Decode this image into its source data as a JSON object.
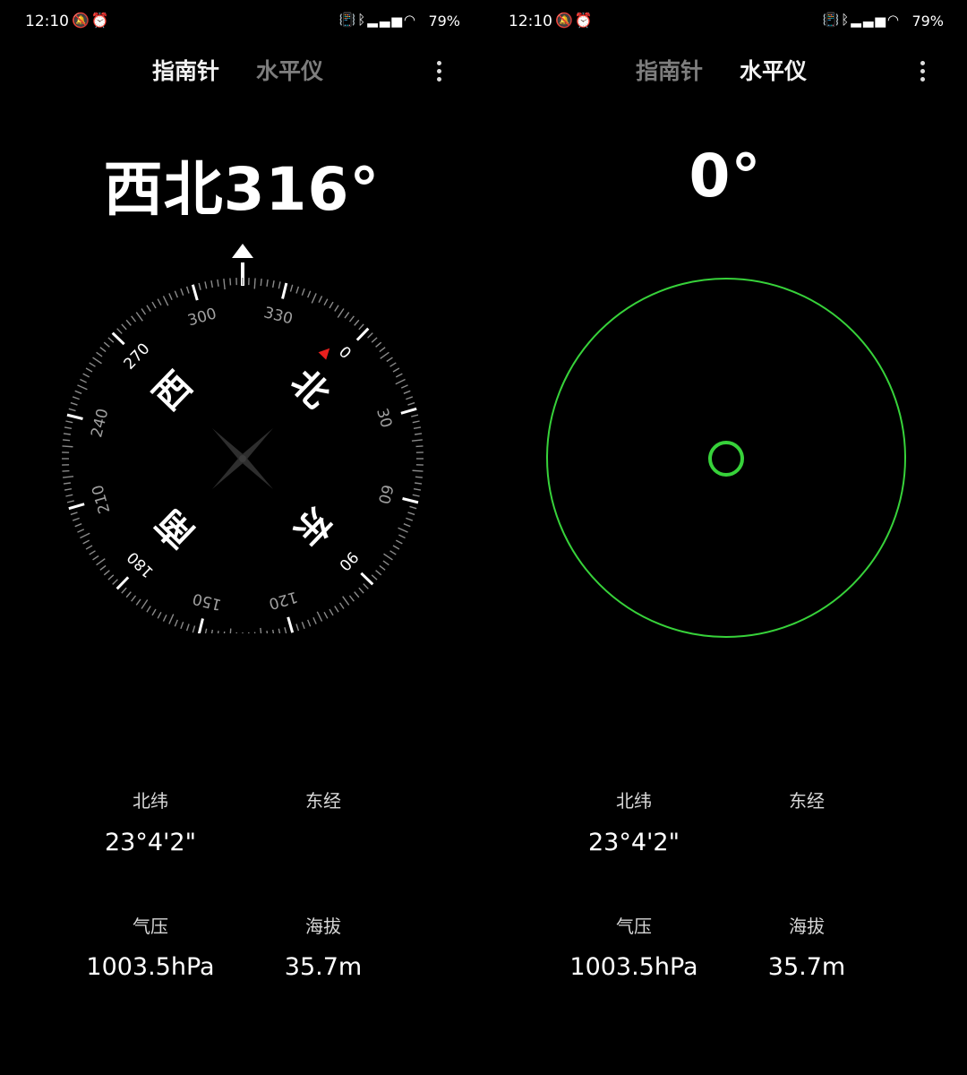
{
  "status_bar": {
    "time": "12:10",
    "battery": "79%",
    "icons": [
      "mute-icon",
      "alarm-icon",
      "vibrate-icon",
      "bluetooth-icon",
      "hd-signal-icon",
      "wifi-icon"
    ]
  },
  "tabs": [
    "指南针",
    "水平仪"
  ],
  "compass": {
    "direction": "西北",
    "degrees": "316°",
    "cardinals": {
      "north": "北",
      "east": "东",
      "south": "南",
      "west": "西"
    },
    "ring_labels": [
      "0",
      "30",
      "60",
      "90",
      "120",
      "150",
      "180",
      "210",
      "240",
      "270",
      "300",
      "330"
    ],
    "north_marker_color": "#e8201e"
  },
  "level": {
    "angle": "0°",
    "ring_color": "#37d23a",
    "bubble_color": "#37d23a"
  },
  "info": {
    "latitude_label": "北纬",
    "latitude_value": "23°4'2\"",
    "longitude_label": "东经",
    "longitude_value": "",
    "pressure_label": "气压",
    "pressure_value": "1003.5hPa",
    "altitude_label": "海拔",
    "altitude_value": "35.7m"
  }
}
